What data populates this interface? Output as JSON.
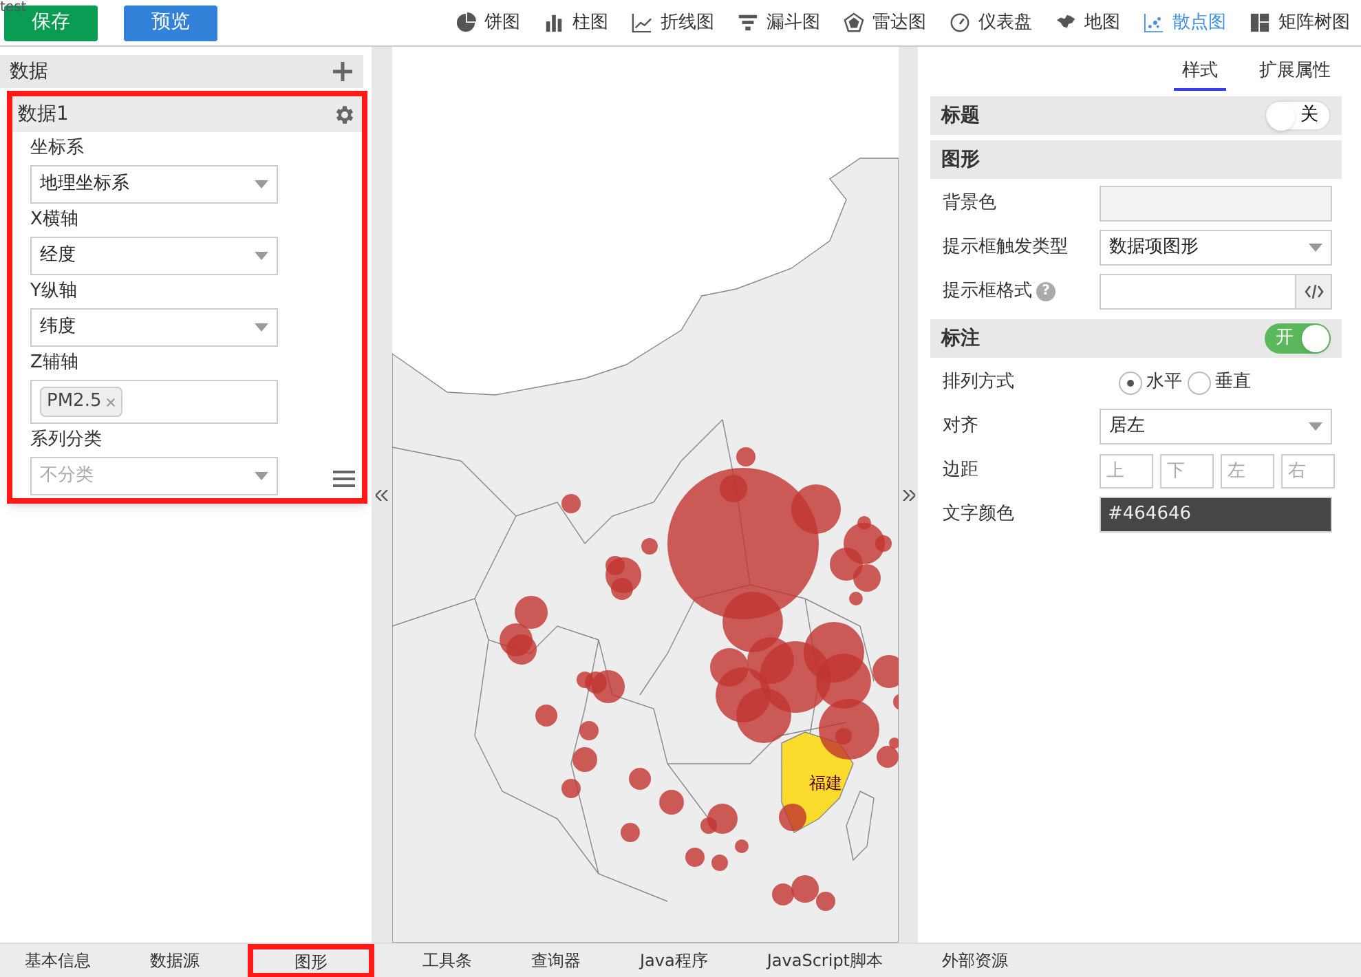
{
  "toolbar": {
    "note": "test",
    "buttons": [
      {
        "label": "保存",
        "kind": "save"
      },
      {
        "label": "预览",
        "kind": "preview"
      }
    ],
    "chart_types": [
      {
        "label": "饼图",
        "kind": "pie",
        "selected": false
      },
      {
        "label": "柱图",
        "kind": "bar",
        "selected": false
      },
      {
        "label": "折线图",
        "kind": "line",
        "selected": false
      },
      {
        "label": "漏斗图",
        "kind": "funnel",
        "selected": false
      },
      {
        "label": "雷达图",
        "kind": "radar",
        "selected": false
      },
      {
        "label": "仪表盘",
        "kind": "gauge",
        "selected": false
      },
      {
        "label": "地图",
        "kind": "map",
        "selected": false
      },
      {
        "label": "散点图",
        "kind": "scatter",
        "selected": true
      },
      {
        "label": "矩阵树图",
        "kind": "treemap",
        "selected": false
      }
    ]
  },
  "data_panel": {
    "title": "数据",
    "series": {
      "title": "数据1",
      "fields": [
        {
          "label": "坐标系",
          "kind": "select",
          "value": "地理坐标系"
        },
        {
          "label": "X横轴",
          "kind": "select",
          "value": "经度"
        },
        {
          "label": "Y纵轴",
          "kind": "select",
          "value": "纬度"
        },
        {
          "label": "Z辅轴",
          "kind": "tags",
          "tags": [
            "PM2.5"
          ]
        },
        {
          "label": "系列分类",
          "kind": "select",
          "placeholder": "不分类"
        }
      ]
    }
  },
  "map": {
    "region_label": "福建"
  },
  "properties": {
    "tabs": [
      {
        "label": "样式",
        "selected": true
      },
      {
        "label": "扩展属性",
        "selected": false
      }
    ],
    "sections": [
      {
        "title": "标题",
        "toggle": {
          "on": false,
          "label": "关"
        }
      },
      {
        "title": "图形",
        "rows": [
          {
            "label": "背景色",
            "kind": "color"
          },
          {
            "label": "提示框触发类型",
            "kind": "select",
            "value": "数据项图形"
          },
          {
            "label": "提示框格式",
            "kind": "code",
            "help": "?"
          }
        ]
      },
      {
        "title": "标注",
        "toggle": {
          "on": true,
          "label": "开"
        },
        "rows": [
          {
            "label": "排列方式",
            "kind": "radio",
            "options": [
              {
                "label": "水平",
                "selected": true
              },
              {
                "label": "垂直",
                "selected": false
              }
            ]
          },
          {
            "label": "对齐",
            "kind": "select",
            "value": "居左"
          },
          {
            "label": "边距",
            "kind": "inputs",
            "placeholders": [
              "上",
              "下",
              "左",
              "右"
            ]
          },
          {
            "label": "文字颜色",
            "kind": "color",
            "value": "#464646"
          }
        ]
      }
    ]
  },
  "bottom_tabs": [
    {
      "label": "基本信息",
      "selected": false
    },
    {
      "label": "数据源",
      "selected": false
    },
    {
      "label": "图形",
      "selected": true
    },
    {
      "label": "工具条",
      "selected": false
    },
    {
      "label": "查询器",
      "selected": false
    },
    {
      "label": "Java程序",
      "selected": false
    },
    {
      "label": "JavaScript脚本",
      "selected": false
    },
    {
      "label": "外部资源",
      "selected": false
    }
  ]
}
